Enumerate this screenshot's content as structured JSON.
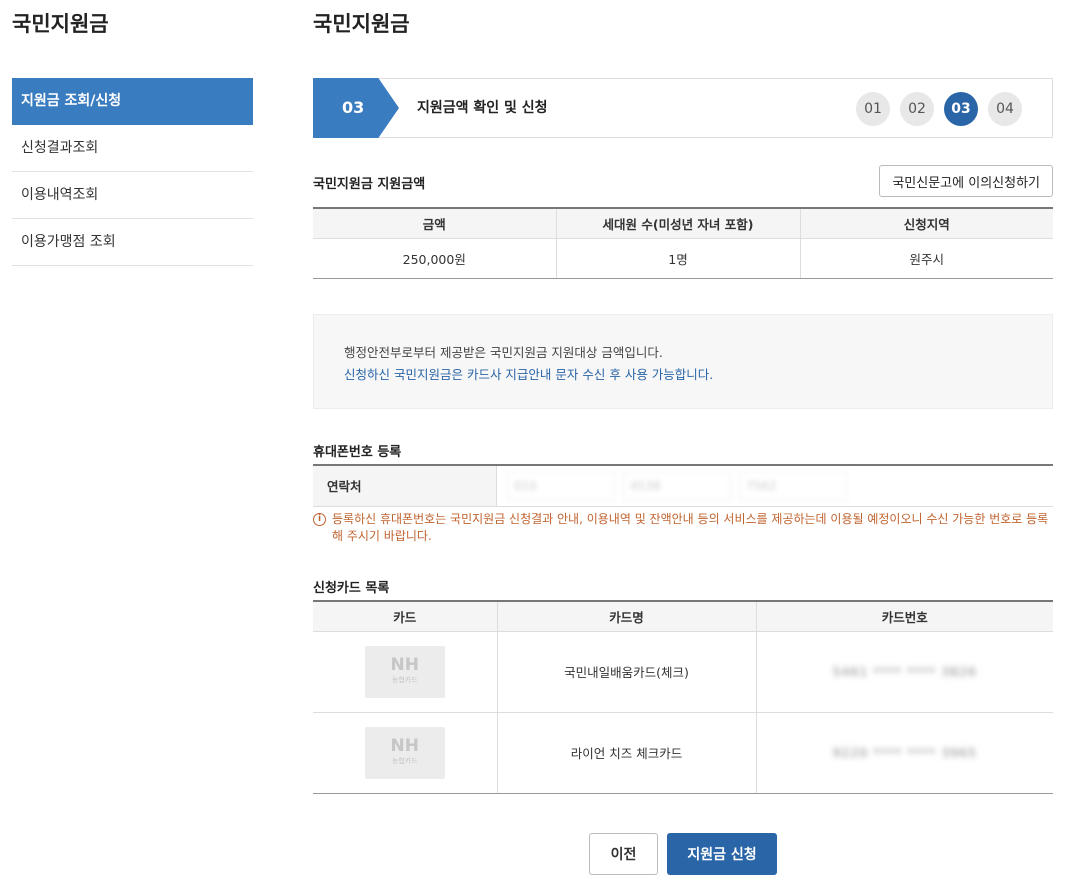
{
  "sidebar": {
    "title": "국민지원금",
    "items": [
      {
        "label": "지원금 조회/신청"
      },
      {
        "label": "신청결과조회"
      },
      {
        "label": "이용내역조회"
      },
      {
        "label": "이용가맹점 조회"
      }
    ]
  },
  "main": {
    "title": "국민지원금",
    "step": {
      "current_number": "03",
      "current_label": "지원금액 확인 및 신청",
      "steps": [
        "01",
        "02",
        "03",
        "04"
      ]
    },
    "amount_section": {
      "title": "국민지원금 지원금액",
      "objection_button": "국민신문고에 이의신청하기",
      "headers": [
        "금액",
        "세대원 수(미성년 자녀 포함)",
        "신청지역"
      ],
      "row": [
        "250,000원",
        "1명",
        "원주시"
      ]
    },
    "notice": {
      "line1": "행정안전부로부터 제공받은 국민지원금 지원대상 금액입니다.",
      "line2": "신청하신 국민지원금은 카드사 지급안내 문자 수신 후 사용 가능합니다."
    },
    "phone_section": {
      "title": "휴대폰번호 등록",
      "label": "연락처",
      "fields": [
        "010",
        "4538",
        "7562"
      ],
      "warning": "등록하신 휴대폰번호는 국민지원금 신청결과 안내, 이용내역 및 잔액안내 등의 서비스를 제공하는데 이용될 예정이오니 수신 가능한 번호로 등록해 주시기 바랍니다."
    },
    "card_section": {
      "title": "신청카드 목록",
      "headers": [
        "카드",
        "카드명",
        "카드번호"
      ],
      "rows": [
        {
          "logo": "NH",
          "logo_sub": "농협카드",
          "name": "국민내일배움카드(체크)",
          "number": "5461 **** **** 3826"
        },
        {
          "logo": "NH",
          "logo_sub": "농협카드",
          "name": "라이언 치즈 체크카드",
          "number": "9220 **** **** 3965"
        }
      ]
    },
    "buttons": {
      "prev": "이전",
      "apply": "지원금 신청"
    }
  },
  "colors": {
    "primary": "#3a7cc0",
    "primary_dark": "#2a65a8",
    "warning": "#c0632f"
  }
}
